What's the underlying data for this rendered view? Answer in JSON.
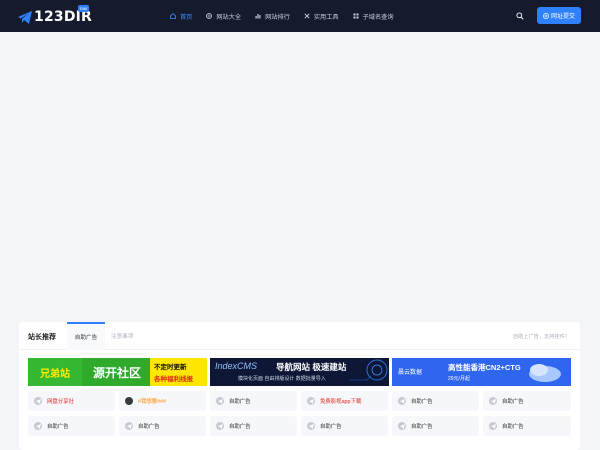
{
  "header": {
    "logo_text": "123DIR",
    "logo_badge": "nav",
    "nav": [
      {
        "label": "首页",
        "icon": "home-icon"
      },
      {
        "label": "网站大全",
        "icon": "globe-icon"
      },
      {
        "label": "网站排行",
        "icon": "bar-chart-icon"
      },
      {
        "label": "实用工具",
        "icon": "tools-icon"
      },
      {
        "label": "子域名查询",
        "icon": "grid-icon"
      }
    ],
    "submit_label": "网址提交",
    "accent": "#2f80ff"
  },
  "panel": {
    "title": "站长推荐",
    "tabs": [
      "自助广告",
      "注意事项"
    ],
    "note": "自助上广告，支持挂件！"
  },
  "banners": [
    {
      "left": "兄弟站",
      "middle": "源开社区",
      "right_top": "不定时更新",
      "right_bottom": "各种福利线报"
    },
    {
      "brand": "IndexCMS",
      "headline": "导航网站 极速建站",
      "sub": "模块化页面 自由排版设计 数据批量导入"
    },
    {
      "brand": "晨云数据",
      "headline": "高性能香港CN2+CTG",
      "price": "29元/月起"
    }
  ],
  "cells_row1": [
    {
      "label": "网盘分享社",
      "style": "red"
    },
    {
      "label": "#我想要###",
      "style": "orange"
    },
    {
      "label": "自助广告",
      "style": "normal"
    },
    {
      "label": "免费影视app下载",
      "style": "red"
    },
    {
      "label": "自助广告",
      "style": "normal"
    },
    {
      "label": "自助广告",
      "style": "normal"
    }
  ],
  "cells_row2": [
    {
      "label": "自助广告"
    },
    {
      "label": "自助广告"
    },
    {
      "label": "自助广告"
    },
    {
      "label": "自助广告"
    },
    {
      "label": "自助广告"
    },
    {
      "label": "自助广告"
    }
  ]
}
